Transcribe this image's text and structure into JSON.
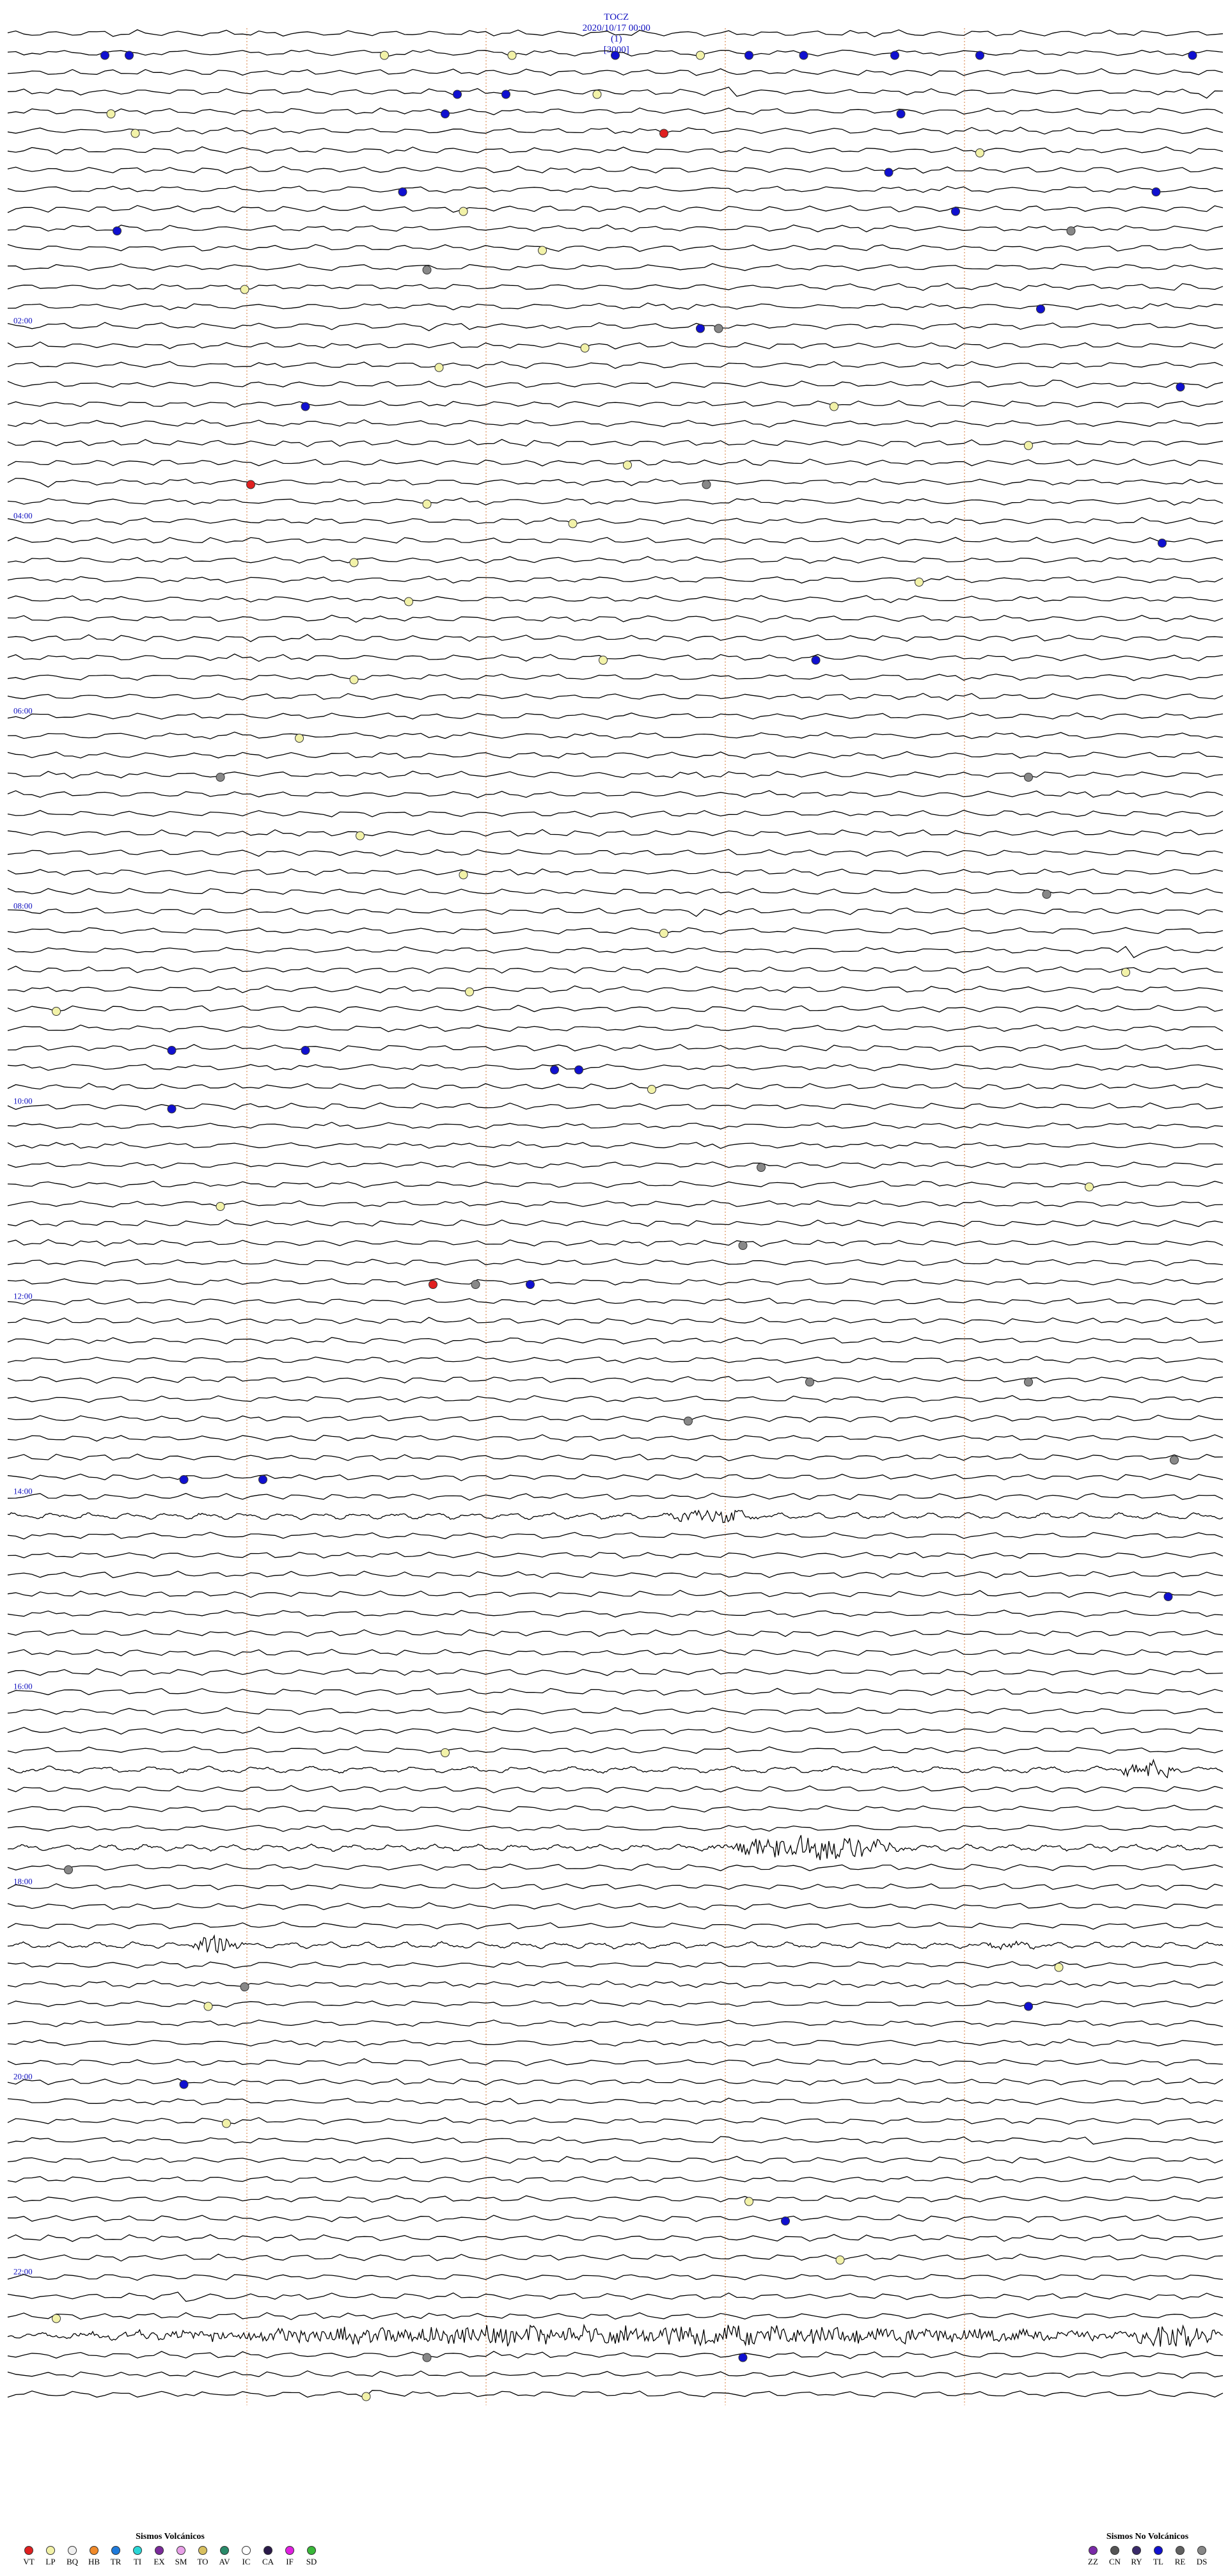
{
  "header": {
    "station": "TOCZ",
    "datetime": "2020/10/17 00:00",
    "channel": "(1)",
    "scale": "[3000]"
  },
  "chart_data": {
    "type": "seismogram",
    "trace_count": 120,
    "traces_per_hour": 5,
    "hour_labels": [
      "02:00",
      "04:00",
      "06:00",
      "08:00",
      "10:00",
      "12:00",
      "14:00",
      "16:00",
      "18:00",
      "20:00",
      "22:00"
    ],
    "time_markers_min": [
      2.4,
      4.8,
      7.2,
      9.6
    ],
    "colors": {
      "trace": "#000000",
      "marker": "#d4783a",
      "label": "#1010c0"
    },
    "bursts": [
      {
        "trace": 3,
        "t": 0.605,
        "w": 0.05,
        "a": 6
      },
      {
        "trace": 3,
        "t": 0.985,
        "w": 0.03,
        "a": 7
      },
      {
        "trace": 13,
        "t": 0.96,
        "w": 0.03,
        "a": 6
      },
      {
        "trace": 15,
        "t": 0.36,
        "w": 0.06,
        "a": 4
      },
      {
        "trace": 15,
        "t": 0.45,
        "w": 0.04,
        "a": 5
      },
      {
        "trace": 18,
        "t": 0.86,
        "w": 0.03,
        "a": 6
      },
      {
        "trace": 23,
        "t": 0.025,
        "w": 0.05,
        "a": 7
      },
      {
        "trace": 23,
        "t": 0.98,
        "w": 0.04,
        "a": 8
      },
      {
        "trace": 45,
        "t": 0.58,
        "w": 0.05,
        "a": 5
      },
      {
        "trace": 47,
        "t": 0.925,
        "w": 0.03,
        "a": 7
      },
      {
        "trace": 57,
        "t": 0.58,
        "w": 0.05,
        "a": 5
      },
      {
        "trace": 76,
        "t": 0.58,
        "w": 0.08,
        "a": 10
      },
      {
        "trace": 86,
        "t": 0.66,
        "w": 0.05,
        "a": 4
      },
      {
        "trace": 89,
        "t": 0.94,
        "w": 0.06,
        "a": 12
      },
      {
        "trace": 93,
        "t": 0.66,
        "w": 0.18,
        "a": 18
      },
      {
        "trace": 98,
        "t": 0.17,
        "w": 0.05,
        "a": 16
      },
      {
        "trace": 98,
        "t": 0.82,
        "w": 0.06,
        "a": 5
      },
      {
        "trace": 106,
        "t": 0.43,
        "w": 0.05,
        "a": 6
      },
      {
        "trace": 106,
        "t": 0.96,
        "w": 0.04,
        "a": 6
      },
      {
        "trace": 108,
        "t": 0.59,
        "w": 0.04,
        "a": 4
      },
      {
        "trace": 108,
        "t": 0.89,
        "w": 0.04,
        "a": 5
      },
      {
        "trace": 112,
        "t": 0.37,
        "w": 0.04,
        "a": 5
      },
      {
        "trace": 116,
        "t": 0.14,
        "w": 0.05,
        "a": 8
      },
      {
        "trace": 118,
        "t": 0.5,
        "w": 1.0,
        "a": 14
      },
      {
        "trace": 118,
        "t": 0.96,
        "w": 0.08,
        "a": 20
      },
      {
        "trace": 121,
        "t": 0.3,
        "w": 0.05,
        "a": 5
      },
      {
        "trace": 123,
        "t": 0.25,
        "w": 0.03,
        "a": 5
      },
      {
        "trace": 146,
        "t": 0.14,
        "w": 0.03,
        "a": 4
      },
      {
        "trace": 146,
        "t": 0.25,
        "w": 0.03,
        "a": 3
      },
      {
        "trace": 175,
        "t": 0.92,
        "w": 0.03,
        "a": 6
      },
      {
        "trace": 180,
        "t": 0.12,
        "w": 0.04,
        "a": 4
      }
    ],
    "events": [
      {
        "trace": 1,
        "t": 0.08,
        "type": "TL"
      },
      {
        "trace": 1,
        "t": 0.1,
        "type": "TL"
      },
      {
        "trace": 1,
        "t": 0.31,
        "type": "LP"
      },
      {
        "trace": 1,
        "t": 0.415,
        "type": "LP"
      },
      {
        "trace": 1,
        "t": 0.5,
        "type": "TL"
      },
      {
        "trace": 1,
        "t": 0.57,
        "type": "LP"
      },
      {
        "trace": 1,
        "t": 0.61,
        "type": "TL"
      },
      {
        "trace": 1,
        "t": 0.655,
        "type": "TL"
      },
      {
        "trace": 1,
        "t": 0.73,
        "type": "TL"
      },
      {
        "trace": 1,
        "t": 0.8,
        "type": "TL"
      },
      {
        "trace": 1,
        "t": 0.975,
        "type": "TL"
      },
      {
        "trace": 3,
        "t": 0.37,
        "type": "TL"
      },
      {
        "trace": 3,
        "t": 0.41,
        "type": "TL"
      },
      {
        "trace": 3,
        "t": 0.485,
        "type": "LP"
      },
      {
        "trace": 4,
        "t": 0.085,
        "type": "LP"
      },
      {
        "trace": 4,
        "t": 0.36,
        "type": "TL"
      },
      {
        "trace": 4,
        "t": 0.735,
        "type": "TL"
      },
      {
        "trace": 5,
        "t": 0.54,
        "type": "VT"
      },
      {
        "trace": 5,
        "t": 0.105,
        "type": "LP"
      },
      {
        "trace": 6,
        "t": 0.8,
        "type": "LP"
      },
      {
        "trace": 7,
        "t": 0.725,
        "type": "TL"
      },
      {
        "trace": 8,
        "t": 0.945,
        "type": "TL"
      },
      {
        "trace": 8,
        "t": 0.325,
        "type": "TL"
      },
      {
        "trace": 9,
        "t": 0.78,
        "type": "TL"
      },
      {
        "trace": 9,
        "t": 0.375,
        "type": "LP"
      },
      {
        "trace": 10,
        "t": 0.09,
        "type": "TL"
      },
      {
        "trace": 10,
        "t": 0.875,
        "type": "DS"
      },
      {
        "trace": 11,
        "t": 0.44,
        "type": "LP"
      },
      {
        "trace": 12,
        "t": 0.345,
        "type": "DS"
      },
      {
        "trace": 13,
        "t": 0.195,
        "type": "LP"
      },
      {
        "trace": 14,
        "t": 0.85,
        "type": "TL"
      },
      {
        "trace": 15,
        "t": 0.57,
        "type": "TL"
      },
      {
        "trace": 15,
        "t": 0.585,
        "type": "DS"
      },
      {
        "trace": 16,
        "t": 0.475,
        "type": "LP"
      },
      {
        "trace": 17,
        "t": 0.355,
        "type": "LP"
      },
      {
        "trace": 18,
        "t": 0.965,
        "type": "TL"
      },
      {
        "trace": 19,
        "t": 0.245,
        "type": "TL"
      },
      {
        "trace": 19,
        "t": 0.68,
        "type": "LP"
      },
      {
        "trace": 21,
        "t": 0.84,
        "type": "LP"
      },
      {
        "trace": 22,
        "t": 0.51,
        "type": "LP"
      },
      {
        "trace": 23,
        "t": 0.2,
        "type": "VT"
      },
      {
        "trace": 23,
        "t": 0.575,
        "type": "DS"
      },
      {
        "trace": 24,
        "t": 0.345,
        "type": "LP"
      },
      {
        "trace": 25,
        "t": 0.465,
        "type": "LP"
      },
      {
        "trace": 26,
        "t": 0.95,
        "type": "TL"
      },
      {
        "trace": 27,
        "t": 0.285,
        "type": "LP"
      },
      {
        "trace": 28,
        "t": 0.75,
        "type": "LP"
      },
      {
        "trace": 29,
        "t": 0.33,
        "type": "LP"
      },
      {
        "trace": 32,
        "t": 0.665,
        "type": "TL"
      },
      {
        "trace": 32,
        "t": 0.49,
        "type": "LP"
      },
      {
        "trace": 33,
        "t": 0.285,
        "type": "LP"
      },
      {
        "trace": 36,
        "t": 0.24,
        "type": "LP"
      },
      {
        "trace": 38,
        "t": 0.84,
        "type": "DS"
      },
      {
        "trace": 38,
        "t": 0.175,
        "type": "DS"
      },
      {
        "trace": 41,
        "t": 0.29,
        "type": "LP"
      },
      {
        "trace": 43,
        "t": 0.375,
        "type": "LP"
      },
      {
        "trace": 44,
        "t": 0.855,
        "type": "DS"
      },
      {
        "trace": 46,
        "t": 0.54,
        "type": "LP"
      },
      {
        "trace": 48,
        "t": 0.92,
        "type": "LP"
      },
      {
        "trace": 49,
        "t": 0.38,
        "type": "LP"
      },
      {
        "trace": 50,
        "t": 0.04,
        "type": "LP"
      },
      {
        "trace": 52,
        "t": 0.135,
        "type": "TL"
      },
      {
        "trace": 52,
        "t": 0.245,
        "type": "TL"
      },
      {
        "trace": 53,
        "t": 0.45,
        "type": "TL"
      },
      {
        "trace": 53,
        "t": 0.47,
        "type": "TL"
      },
      {
        "trace": 54,
        "t": 0.53,
        "type": "LP"
      },
      {
        "trace": 55,
        "t": 0.135,
        "type": "TL"
      },
      {
        "trace": 58,
        "t": 0.62,
        "type": "DS"
      },
      {
        "trace": 59,
        "t": 0.89,
        "type": "LP"
      },
      {
        "trace": 60,
        "t": 0.175,
        "type": "LP"
      },
      {
        "trace": 62,
        "t": 0.605,
        "type": "DS"
      },
      {
        "trace": 64,
        "t": 0.35,
        "type": "VT"
      },
      {
        "trace": 64,
        "t": 0.385,
        "type": "DS"
      },
      {
        "trace": 64,
        "t": 0.43,
        "type": "TL"
      },
      {
        "trace": 69,
        "t": 0.66,
        "type": "DS"
      },
      {
        "trace": 69,
        "t": 0.84,
        "type": "DS"
      },
      {
        "trace": 71,
        "t": 0.56,
        "type": "DS"
      },
      {
        "trace": 73,
        "t": 0.96,
        "type": "DS"
      },
      {
        "trace": 74,
        "t": 0.145,
        "type": "TL"
      },
      {
        "trace": 74,
        "t": 0.21,
        "type": "TL"
      },
      {
        "trace": 80,
        "t": 0.955,
        "type": "TL"
      },
      {
        "trace": 88,
        "t": 0.36,
        "type": "LP"
      },
      {
        "trace": 94,
        "t": 0.05,
        "type": "DS"
      },
      {
        "trace": 99,
        "t": 0.865,
        "type": "LP"
      },
      {
        "trace": 100,
        "t": 0.195,
        "type": "DS"
      },
      {
        "trace": 101,
        "t": 0.165,
        "type": "LP"
      },
      {
        "trace": 101,
        "t": 0.84,
        "type": "TL"
      },
      {
        "trace": 105,
        "t": 0.145,
        "type": "TL"
      },
      {
        "trace": 107,
        "t": 0.18,
        "type": "LP"
      },
      {
        "trace": 111,
        "t": 0.61,
        "type": "LP"
      },
      {
        "trace": 112,
        "t": 0.64,
        "type": "TL"
      },
      {
        "trace": 114,
        "t": 0.685,
        "type": "LP"
      },
      {
        "trace": 117,
        "t": 0.04,
        "type": "LP"
      },
      {
        "trace": 119,
        "t": 0.345,
        "type": "DS"
      },
      {
        "trace": 119,
        "t": 0.605,
        "type": "TL"
      },
      {
        "trace": 121,
        "t": 0.295,
        "type": "LP"
      },
      {
        "trace": 122,
        "t": 0.265,
        "type": "TL"
      },
      {
        "trace": 124,
        "t": 0.775,
        "type": "LP"
      },
      {
        "trace": 126,
        "t": 0.04,
        "type": "LP"
      },
      {
        "trace": 128,
        "t": 0.605,
        "type": "TL"
      },
      {
        "trace": 128,
        "t": 0.48,
        "type": "TL"
      },
      {
        "trace": 130,
        "t": 0.935,
        "type": "LP"
      },
      {
        "trace": 132,
        "t": 0.745,
        "type": "DS"
      },
      {
        "trace": 134,
        "t": 0.185,
        "type": "TL"
      },
      {
        "trace": 134,
        "t": 0.26,
        "type": "DS"
      },
      {
        "trace": 135,
        "t": 0.62,
        "type": "LP"
      },
      {
        "trace": 136,
        "t": 0.09,
        "type": "TL"
      },
      {
        "trace": 137,
        "t": 0.245,
        "type": "TL"
      }
    ]
  },
  "legend_volcanic": {
    "title": "Sismos Volcánicos",
    "items": [
      {
        "code": "VT",
        "color": "#e02020"
      },
      {
        "code": "LP",
        "color": "#f2f2a8"
      },
      {
        "code": "BQ",
        "color": "#f0f0f0"
      },
      {
        "code": "HB",
        "color": "#f08a2a"
      },
      {
        "code": "TR",
        "color": "#1f7bdc"
      },
      {
        "code": "TI",
        "color": "#2ad6d6"
      },
      {
        "code": "EX",
        "color": "#7a2a9a"
      },
      {
        "code": "SM",
        "color": "#e8a0e8"
      },
      {
        "code": "TO",
        "color": "#d8c060"
      },
      {
        "code": "AV",
        "color": "#2a8a6a"
      },
      {
        "code": "IC",
        "color": "#ffffff"
      },
      {
        "code": "CA",
        "color": "#2a1a4a"
      },
      {
        "code": "IF",
        "color": "#e020e0"
      },
      {
        "code": "SD",
        "color": "#3ab83a"
      }
    ]
  },
  "legend_nonvolcanic": {
    "title": "Sismos No Volcánicos",
    "items": [
      {
        "code": "ZZ",
        "color": "#7a2aa8"
      },
      {
        "code": "CN",
        "color": "#555555"
      },
      {
        "code": "RY",
        "color": "#3a2a6a"
      },
      {
        "code": "TL",
        "color": "#1010d0"
      },
      {
        "code": "RE",
        "color": "#606060"
      },
      {
        "code": "DS",
        "color": "#888888"
      }
    ]
  }
}
